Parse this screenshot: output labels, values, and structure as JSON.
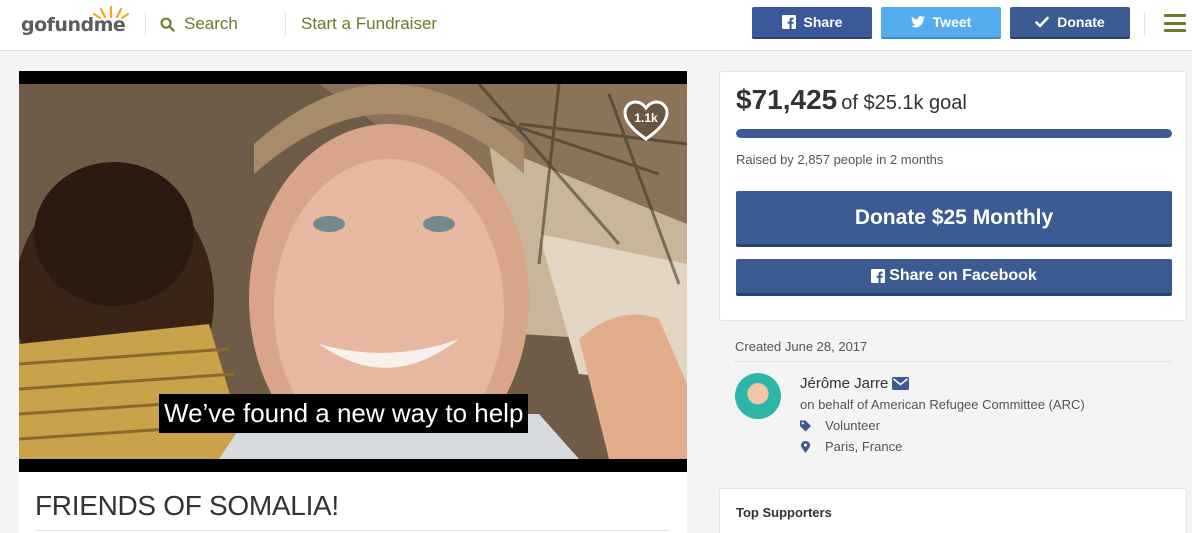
{
  "header": {
    "logo": {
      "part1": "go",
      "part2": "fund",
      "part3": "me"
    },
    "search_label": "Search",
    "start_label": "Start a Fundraiser",
    "share_label": "Share",
    "tweet_label": "Tweet",
    "donate_label": "Donate"
  },
  "video": {
    "caption": "We’ve found a new way to help",
    "likes": "1.1k"
  },
  "campaign": {
    "title": "FRIENDS OF SOMALIA!"
  },
  "donation": {
    "raised_amount": "$71,425",
    "goal_text": "of $25.1k goal",
    "progress_fraction": 1.0,
    "raised_by": "Raised by 2,857 people in 2 months",
    "donate_monthly_label": "Donate $25 Monthly",
    "share_facebook_label": "Share on Facebook"
  },
  "organizer": {
    "created": "Created June 28, 2017",
    "name": "Jérôme Jarre",
    "on_behalf": "on behalf of American Refugee Committee (ARC)",
    "role": "Volunteer",
    "location": "Paris, France"
  },
  "supporters": {
    "title": "Top Supporters"
  },
  "colors": {
    "brand_green": "#6b7a2d",
    "facebook": "#3b5998",
    "twitter": "#55acee",
    "donate_blue": "#3c5b92",
    "logo_sun": "#f5a623"
  },
  "icons": {
    "search": "search-icon",
    "facebook": "facebook-icon",
    "twitter": "twitter-icon",
    "check": "check-icon",
    "menu": "hamburger-menu-icon",
    "heart": "heart-icon",
    "envelope": "envelope-icon",
    "tag": "tag-icon",
    "pin": "map-pin-icon"
  }
}
